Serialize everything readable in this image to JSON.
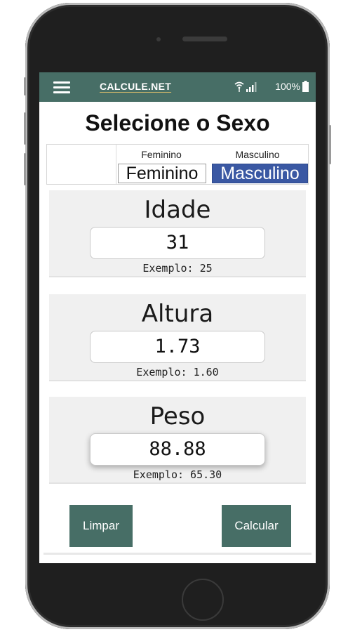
{
  "appbar": {
    "menu_icon": "hamburger-menu-icon",
    "brand": "CALCULE.NET",
    "battery": "100%",
    "wifi_icon": "wifi-icon",
    "signal_icon": "signal-icon",
    "battery_icon": "battery-icon"
  },
  "page": {
    "title": "Selecione o Sexo"
  },
  "sex": {
    "female_label": "Feminino",
    "female_button": "Feminino",
    "male_label": "Masculino",
    "male_button": "Masculino",
    "selected": "Masculino"
  },
  "fields": {
    "age": {
      "title": "Idade",
      "value": "31",
      "hint": "Exemplo: 25"
    },
    "height": {
      "title": "Altura",
      "value": "1.73",
      "hint": "Exemplo: 1.60"
    },
    "weight": {
      "title": "Peso",
      "value": "88.88",
      "hint": "Exemplo: 65.30"
    }
  },
  "actions": {
    "clear": "Limpar",
    "calculate": "Calcular"
  },
  "colors": {
    "primary": "#476e66",
    "selected": "#3a58a3"
  }
}
